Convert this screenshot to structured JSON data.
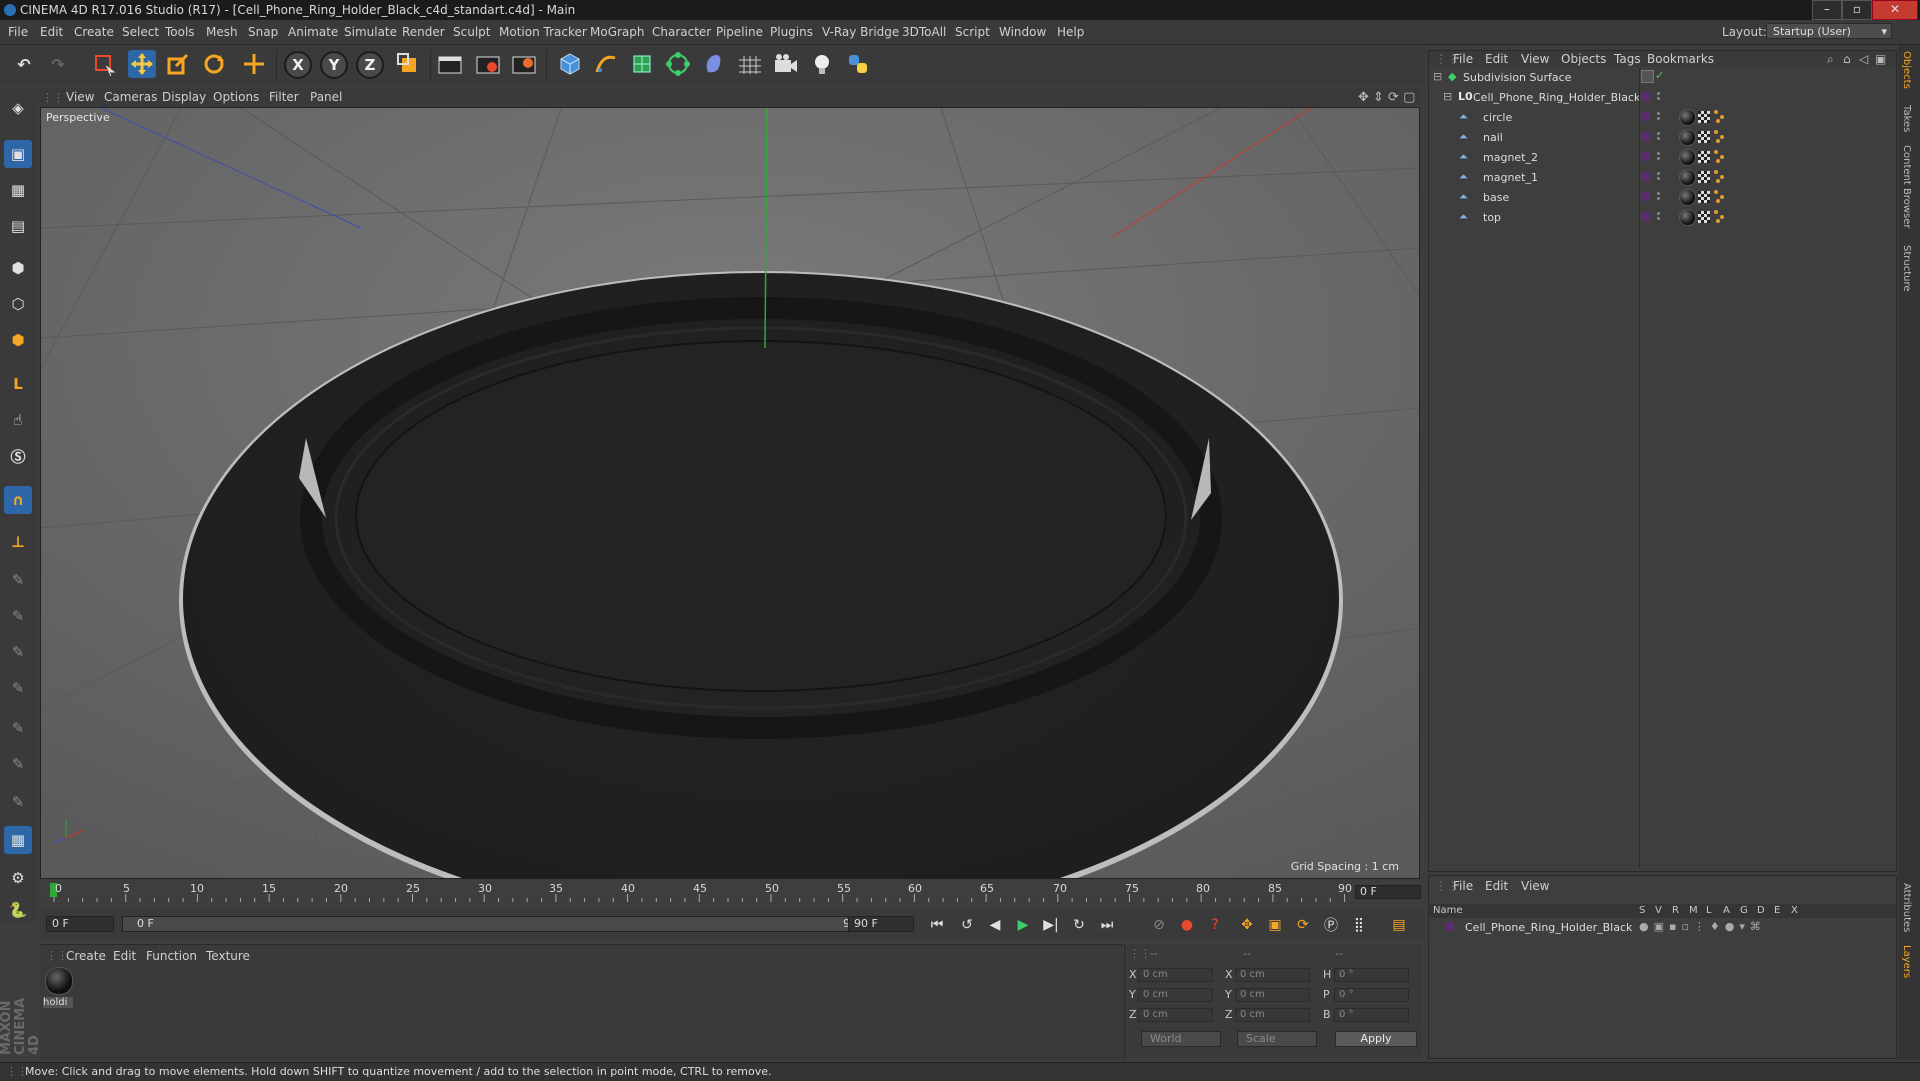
{
  "window": {
    "title": "CINEMA 4D R17.016 Studio (R17) - [Cell_Phone_Ring_Holder_Black_c4d_standart.c4d] - Main",
    "controls": [
      "–",
      "▫",
      "✕"
    ]
  },
  "menubar": {
    "items": [
      "File",
      "Edit",
      "Create",
      "Select",
      "Tools",
      "Mesh",
      "Snap",
      "Animate",
      "Simulate",
      "Render",
      "Sculpt",
      "Motion Tracker",
      "MoGraph",
      "Character",
      "Pipeline",
      "Plugins",
      "V-Ray Bridge",
      "3DToAll",
      "Script",
      "Window",
      "Help"
    ],
    "layout_label": "Layout:",
    "layout_value": "Startup (User)"
  },
  "toolbar": {
    "icons": [
      "undo-icon",
      "redo-icon",
      "live-selection-icon",
      "move-icon",
      "scale-icon",
      "rotate-icon",
      "transform-icon",
      "x-axis-icon",
      "y-axis-icon",
      "z-axis-icon",
      "world-coordinates-icon",
      "render-view-icon",
      "render-picture-viewer-icon",
      "edit-render-settings-icon",
      "cube-icon",
      "spline-pen-icon",
      "subdivision-icon",
      "array-icon",
      "deformer-icon",
      "floor-icon",
      "camera-icon",
      "light-icon",
      "python-icon"
    ],
    "axis_labels": [
      "X",
      "Y",
      "Z"
    ]
  },
  "viewport": {
    "menu": [
      "View",
      "Cameras",
      "Display",
      "Options",
      "Filter",
      "Panel"
    ],
    "camera_label": "Perspective",
    "grid_spacing": "Grid Spacing : 1 cm"
  },
  "timeline": {
    "ticks": [
      "0",
      "5",
      "10",
      "15",
      "20",
      "25",
      "30",
      "35",
      "40",
      "45",
      "50",
      "55",
      "60",
      "65",
      "70",
      "75",
      "80",
      "85",
      "90"
    ],
    "current_frame_right": "0 F"
  },
  "transport": {
    "start_frame": "0 F",
    "range_start": "0 F",
    "range_end": "90 F",
    "end_frame": "90 F"
  },
  "material_manager": {
    "menu": [
      "Create",
      "Edit",
      "Function",
      "Texture"
    ],
    "materials": [
      {
        "name": "holdi"
      }
    ]
  },
  "coordinates": {
    "headers": [
      "--",
      "--",
      "--"
    ],
    "rows": [
      {
        "l1": "X",
        "v1": "0 cm",
        "l2": "X",
        "v2": "0 cm",
        "l3": "H",
        "v3": "0 °"
      },
      {
        "l1": "Y",
        "v1": "0 cm",
        "l2": "Y",
        "v2": "0 cm",
        "l3": "P",
        "v3": "0 °"
      },
      {
        "l1": "Z",
        "v1": "0 cm",
        "l2": "Z",
        "v2": "0 cm",
        "l3": "B",
        "v3": "0 °"
      }
    ],
    "mode_world": "World",
    "mode_scale": "Scale",
    "apply_label": "Apply"
  },
  "status": {
    "text": "Move: Click and drag to move elements. Hold down SHIFT to quantize movement / add to the selection in point mode, CTRL to remove."
  },
  "maxon_logo": "MAXON CINEMA 4D",
  "object_manager": {
    "menu": [
      "File",
      "Edit",
      "View",
      "Objects",
      "Tags",
      "Bookmarks"
    ],
    "objects": [
      {
        "name": "Subdivision Surface",
        "depth": 0,
        "icon": "subdivision-icon"
      },
      {
        "name": "Cell_Phone_Ring_Holder_Black",
        "depth": 1,
        "icon": "null-icon"
      },
      {
        "name": "circle",
        "depth": 2,
        "icon": "polygon-object-icon"
      },
      {
        "name": "nail",
        "depth": 2,
        "icon": "polygon-object-icon"
      },
      {
        "name": "magnet_2",
        "depth": 2,
        "icon": "polygon-object-icon"
      },
      {
        "name": "magnet_1",
        "depth": 2,
        "icon": "polygon-object-icon"
      },
      {
        "name": "base",
        "depth": 2,
        "icon": "polygon-object-icon"
      },
      {
        "name": "top",
        "depth": 2,
        "icon": "polygon-object-icon"
      }
    ]
  },
  "right_tabs": [
    "Objects",
    "Takes",
    "Content Browser",
    "Structure",
    "Attributes",
    "Layers"
  ],
  "layer_manager": {
    "menu": [
      "File",
      "Edit",
      "View"
    ],
    "columns": [
      "Name",
      "S",
      "V",
      "R",
      "M",
      "L",
      "A",
      "G",
      "D",
      "E",
      "X"
    ],
    "layers": [
      {
        "name": "Cell_Phone_Ring_Holder_Black"
      }
    ]
  },
  "colors": {
    "background": "#3d3d3d",
    "viewport_bg": "#6b6b6b",
    "object_color": "#1f1f1f",
    "accent_blue": "#4a90d9",
    "orange_tag": "#e29a2e"
  }
}
